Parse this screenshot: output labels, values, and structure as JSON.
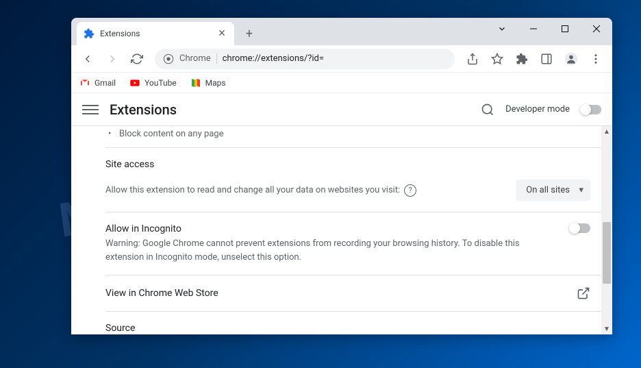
{
  "watermark": "MYANTISPYWARE.COM",
  "tab": {
    "title": "Extensions"
  },
  "address": {
    "prefix": "Chrome",
    "url": "chrome://extensions/?id="
  },
  "bookmarks": {
    "gmail": "Gmail",
    "youtube": "YouTube",
    "maps": "Maps"
  },
  "header": {
    "title": "Extensions",
    "dev_mode": "Developer mode"
  },
  "content": {
    "bullet": "Block content on any page",
    "site_access": {
      "label": "Site access",
      "text": "Allow this extension to read and change all your data on websites you visit:",
      "dropdown": "On all sites"
    },
    "incognito": {
      "title": "Allow in Incognito",
      "warning": "Warning: Google Chrome cannot prevent extensions from recording your browsing history. To disable this extension in Incognito mode, unselect this option."
    },
    "webstore": "View in Chrome Web Store",
    "source": "Source"
  }
}
